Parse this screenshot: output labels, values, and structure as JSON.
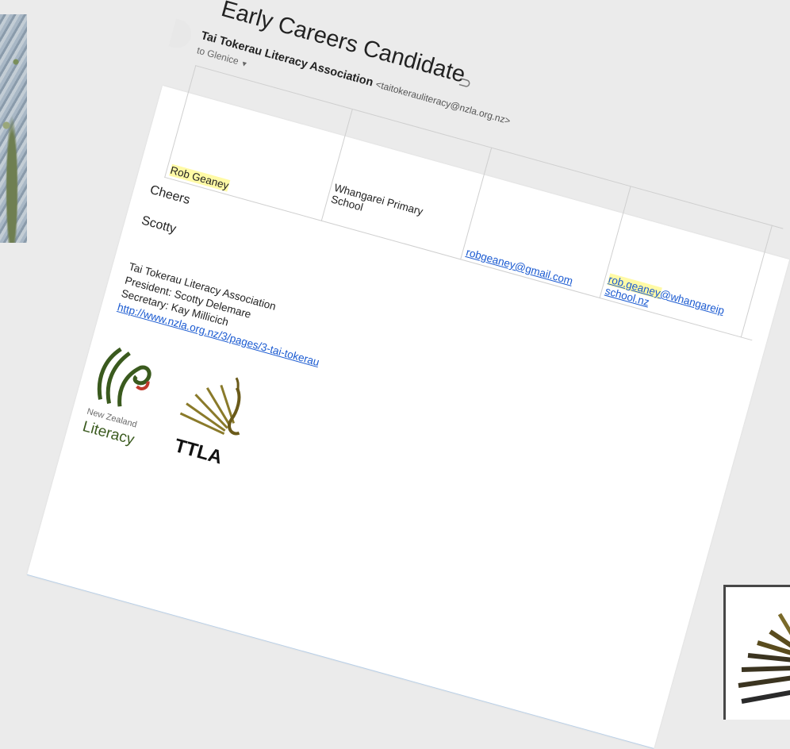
{
  "email": {
    "subject": "Early Careers Candidate",
    "label_icon": "label-icon",
    "sender_name": "Tai Tokerau Literacy Association",
    "sender_email": "<taitokerauliteracy@nzla.org.nz>",
    "to_line": "to Glenice",
    "to_dropdown_icon": "chevron-down-icon"
  },
  "candidate_table": {
    "name": "Rob Geaney",
    "school_line1": "Whangarei Primary",
    "school_line2": "School",
    "personal_email": "robgeaney@gmail.com",
    "school_email_part1": "rob.geaney",
    "school_email_part2": "@whangareip",
    "school_email_part3": "school.nz"
  },
  "body": {
    "closing": "Cheers",
    "signoff": "Scotty"
  },
  "signature": {
    "org": "Tai Tokerau Literacy Association",
    "president": "President: Scotty Delemare",
    "secretary": "Secretary: Kay Millicich",
    "url": "http://www.nzla.org.nz/3/pages/3-tai-tokerau"
  },
  "logos": {
    "nzla_line1": "New Zealand",
    "nzla_line2": "Literacy",
    "ttla": "TTLA"
  },
  "colors": {
    "highlight": "#fffaa6",
    "link": "#1a5ad1",
    "nzla_green": "#3a5a1e",
    "nzla_red": "#c0392b",
    "ttla_gold": "#8a7a2a"
  }
}
